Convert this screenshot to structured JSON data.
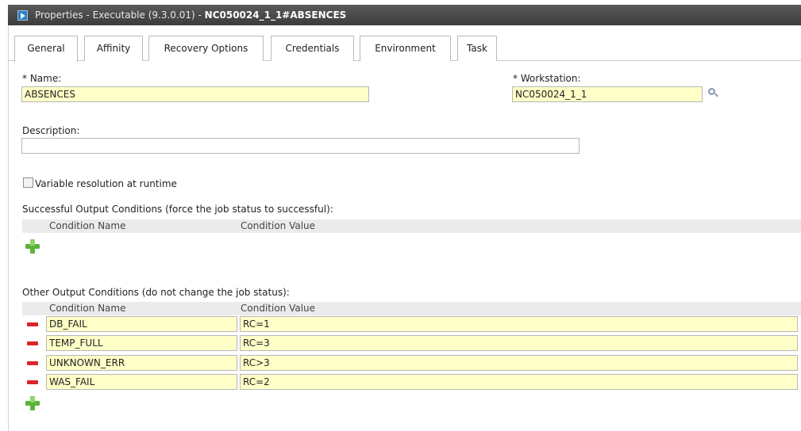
{
  "window": {
    "title_prefix": "Properties - Executable (9.3.0.01) - ",
    "title_bold": "NC050024_1_1#ABSENCES"
  },
  "tabs": [
    {
      "label": "General",
      "active": true
    },
    {
      "label": "Affinity"
    },
    {
      "label": "Recovery Options"
    },
    {
      "label": "Credentials"
    },
    {
      "label": "Environment"
    },
    {
      "label": "Task"
    }
  ],
  "form": {
    "name_label": "* Name:",
    "name_value": "ABSENCES",
    "workstation_label": "* Workstation:",
    "workstation_value": "NC050024_1_1",
    "description_label": "Description:",
    "description_value": "",
    "variable_resolution_label": "Variable resolution at runtime",
    "variable_resolution_checked": false
  },
  "successful_conditions": {
    "heading": "Successful Output Conditions (force the job status to successful):",
    "col_name": "Condition Name",
    "col_value": "Condition Value"
  },
  "other_conditions": {
    "heading": "Other Output Conditions (do not change the job status):",
    "col_name": "Condition Name",
    "col_value": "Condition Value",
    "rows": [
      {
        "name": "DB_FAIL",
        "value": "RC=1"
      },
      {
        "name": "TEMP_FULL",
        "value": "RC=3"
      },
      {
        "name": "UNKNOWN_ERR",
        "value": "RC>3"
      },
      {
        "name": "WAS_FAIL",
        "value": "RC=2"
      }
    ]
  },
  "icons": {
    "window": "play-icon",
    "lookup": "search-icon",
    "add": "add-icon",
    "remove": "remove-icon"
  }
}
